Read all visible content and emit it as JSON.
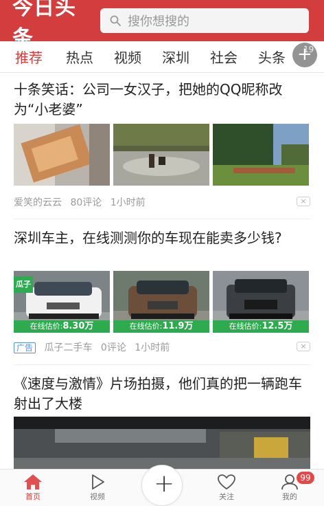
{
  "header": {
    "logo": "今日头条",
    "search_placeholder": "搜你想搜的"
  },
  "tabs": {
    "items": [
      "推荐",
      "热点",
      "视频",
      "深圳",
      "社会",
      "头条"
    ],
    "active_index": 0,
    "plus_label": "+",
    "plus_count": "19"
  },
  "feed": [
    {
      "title": "十条笑话：公司一女汉子，把她的QQ昵称改为“小老婆”",
      "source": "爱笑的云云",
      "comments": "80评论",
      "time": "1小时前"
    },
    {
      "title": "深圳车主，在线测测你的车现在能卖多少钱?",
      "ad_label": "广告",
      "source": "瓜子二手车",
      "comments": "0评论",
      "time": "1小时前",
      "brand_tag": "瓜子",
      "prices": [
        {
          "label": "在线估价:",
          "value": "8.30万"
        },
        {
          "label": "在线估价:",
          "value": "11.9万"
        },
        {
          "label": "在线估价:",
          "value": "12.5万"
        }
      ]
    },
    {
      "title": "《速度与激情》片场拍摄，他们真的把一辆跑车射出了大楼"
    }
  ],
  "dismiss_glyph": "×",
  "bottom_nav": {
    "items": [
      {
        "label": "首页",
        "icon": "home-icon",
        "active": true
      },
      {
        "label": "视频",
        "icon": "play-icon",
        "active": false
      },
      {
        "label": "关注",
        "icon": "heart-icon",
        "active": false
      },
      {
        "label": "我的",
        "icon": "user-icon",
        "active": false
      }
    ],
    "fab_label": "+",
    "badge_count": "99"
  },
  "colors": {
    "brand": "#d43d3d",
    "price_green": "#2eaa4f",
    "ad_blue": "#5a8fd8"
  }
}
